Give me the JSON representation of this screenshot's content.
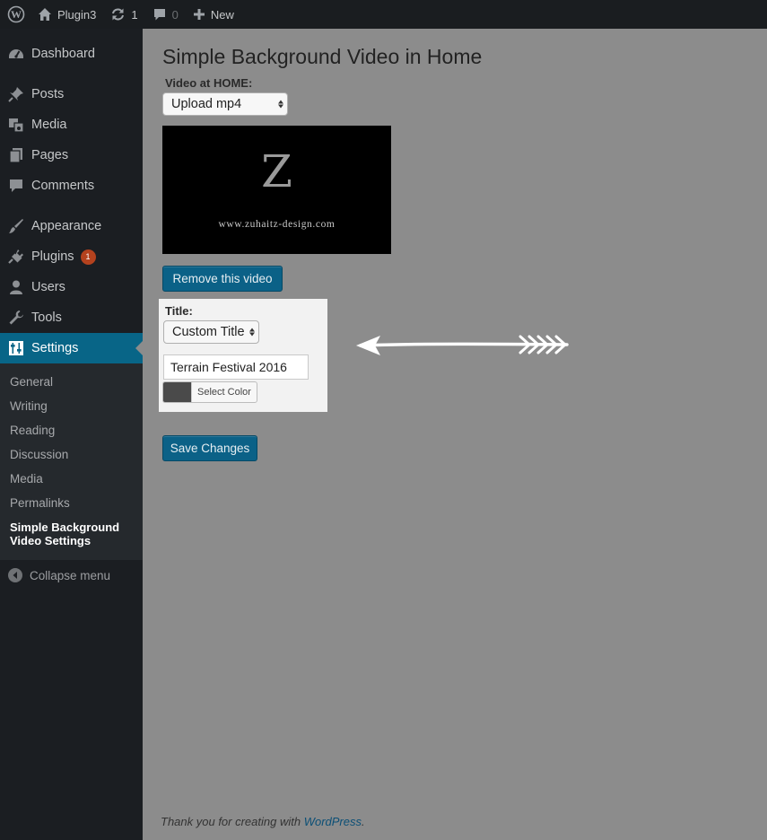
{
  "admin_bar": {
    "site_name": "Plugin3",
    "updates_count": "1",
    "comments_count": "0",
    "new_label": "New"
  },
  "sidebar": {
    "items": [
      {
        "label": "Dashboard",
        "icon": "dashboard-icon"
      },
      {
        "label": "Posts",
        "icon": "pin-icon"
      },
      {
        "label": "Media",
        "icon": "media-icon"
      },
      {
        "label": "Pages",
        "icon": "pages-icon"
      },
      {
        "label": "Comments",
        "icon": "comment-icon"
      },
      {
        "label": "Appearance",
        "icon": "brush-icon"
      },
      {
        "label": "Plugins",
        "icon": "plug-icon",
        "badge": "1"
      },
      {
        "label": "Users",
        "icon": "user-icon"
      },
      {
        "label": "Tools",
        "icon": "wrench-icon"
      },
      {
        "label": "Settings",
        "icon": "settings-icon"
      }
    ],
    "submenu": [
      "General",
      "Writing",
      "Reading",
      "Discussion",
      "Media",
      "Permalinks"
    ],
    "submenu_current": "Simple Background Video Settings",
    "collapse_label": "Collapse menu"
  },
  "main": {
    "page_title": "Simple Background Video in Home",
    "video_label": "Video at HOME:",
    "video_select_value": "Upload mp4",
    "video_preview": {
      "logo_letter": "Z",
      "logo_url": "www.zuhaitz-design.com"
    },
    "remove_button": "Remove this video",
    "title_label": "Title:",
    "title_select_value": "Custom Title",
    "title_input_value": "Terrain Festival 2016",
    "select_color_label": "Select Color",
    "selected_color": "#4a4a4a",
    "save_button": "Save Changes"
  },
  "footer": {
    "thanks_text": "Thank you for creating with ",
    "link_text": "WordPress",
    "period": "."
  },
  "colors": {
    "accent": "#086587",
    "sidebar_bg": "#1b1e22",
    "content_bg": "#8c8c8c"
  }
}
